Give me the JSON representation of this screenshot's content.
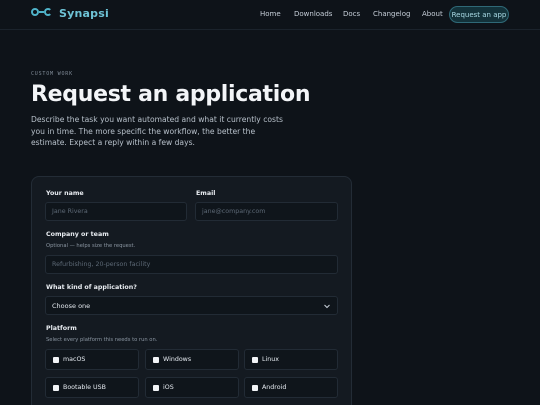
{
  "nav": {
    "brand": "Synapsi",
    "links": [
      "Home",
      "Downloads",
      "Docs",
      "Changelog",
      "About"
    ],
    "cta": "Request an app"
  },
  "hero": {
    "eyebrow": "CUSTOM WORK",
    "title": "Request an application",
    "lede": "Describe the task you want automated and what it currently costs you in time. The more specific the workflow, the better the estimate. Expect a reply within a few days."
  },
  "form": {
    "name_label": "Your name",
    "name_placeholder": "Jane Rivera",
    "email_label": "Email",
    "email_placeholder": "jane@company.com",
    "company_label": "Company or team",
    "company_hint": "Optional — helps size the request.",
    "company_placeholder": "Refurbishing, 20-person facility",
    "kind_label": "What kind of application?",
    "kind_value": "Choose one",
    "platform_label": "Platform",
    "platform_hint": "Select every platform this needs to run on.",
    "platforms": [
      "macOS",
      "Windows",
      "Linux",
      "Bootable USB",
      "iOS",
      "Android"
    ]
  }
}
